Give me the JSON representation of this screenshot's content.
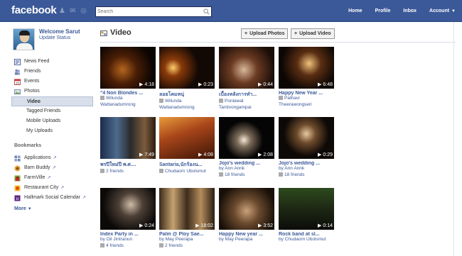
{
  "topbar": {
    "logo": "facebook",
    "search_placeholder": "Search",
    "nav": [
      "Home",
      "Profile",
      "Inbox",
      "Account"
    ]
  },
  "sidebar": {
    "welcome": "Welcome Sarut",
    "update_status": "Update Status",
    "menu": [
      {
        "label": "News Feed"
      },
      {
        "label": "Friends"
      },
      {
        "label": "Events"
      },
      {
        "label": "Photos"
      }
    ],
    "photos_sub": [
      {
        "label": "Video",
        "active": true
      },
      {
        "label": "Tagged Friends"
      },
      {
        "label": "Mobile Uploads"
      },
      {
        "label": "My Uploads"
      }
    ],
    "bookmarks_title": "Bookmarks",
    "bookmarks": [
      {
        "label": "Applications"
      },
      {
        "label": "Barn Buddy"
      },
      {
        "label": "FarmVille"
      },
      {
        "label": "Restaurant City"
      },
      {
        "label": "Hallmark Social Calendar"
      }
    ],
    "more": "More"
  },
  "main": {
    "title": "Video",
    "upload_photos": "Upload Photos",
    "upload_video": "Upload Video",
    "videos": [
      {
        "title": "\"4 Non Blondes ...",
        "duration": "4:18",
        "line1": "Wilunda",
        "line2": "Wattanadumrong",
        "tagged": true
      },
      {
        "title": "ลอยโคมหนุ่",
        "duration": "0:23",
        "line1": "Wilunda",
        "line2": "Wattanadumrong",
        "tagged": true
      },
      {
        "title": "เบื้องหลังการทำ...",
        "duration": "0:44",
        "line1": "Ponlawat",
        "line2": "Tantivongampai",
        "tagged": true
      },
      {
        "title": "Happy New Year ...",
        "duration": "6:48",
        "line1": "Pathavi",
        "line2": "Theerawongseri",
        "tagged": true
      },
      {
        "title": "พรปีใหม่ปี พ.ศ....",
        "duration": "7:49",
        "line1": "2 friends",
        "line2": "",
        "tagged": true
      },
      {
        "title": "Santaria,นักร้องน...",
        "duration": "4:08",
        "line1": "Chudaorn Ubolsmut",
        "line2": "",
        "tagged": true
      },
      {
        "title": "Jojo's wedding ...",
        "duration": "2:08",
        "line1": "by Ann Annk",
        "line2": "18 friends",
        "tagged": true
      },
      {
        "title": "Jojo's wedding ...",
        "duration": "0:29",
        "line1": "by Ann Annk",
        "line2": "18 friends",
        "tagged": true
      },
      {
        "title": "Index Party in ...",
        "duration": "0:24",
        "line1": "by Oil Jintranun",
        "line2": "4 friends",
        "tagged": true
      },
      {
        "title": "Palm @ Ploy Sae...",
        "duration": "18:02",
        "line1": "by May Peerapa",
        "line2": "2 friends",
        "tagged": true
      },
      {
        "title": "Happy New year ...",
        "duration": "3:52",
        "line1": "by May Peerapa",
        "line2": "",
        "tagged": false
      },
      {
        "title": "Rock band at sl...",
        "duration": "0:14",
        "line1": "by Chudaorn Ubolsmut",
        "line2": "",
        "tagged": false
      }
    ]
  },
  "colors": {
    "brand": "#3b5998",
    "active_bg": "#d8dfea"
  }
}
